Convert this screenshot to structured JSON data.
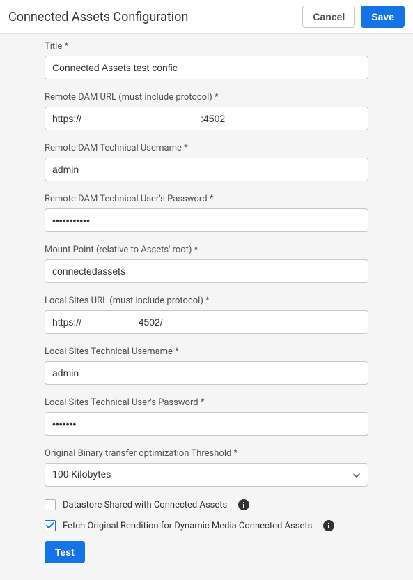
{
  "header": {
    "title": "Connected Assets Configuration",
    "cancel_label": "Cancel",
    "save_label": "Save"
  },
  "fields": {
    "title_label": "Title *",
    "title_value": "Connected Assets test confic",
    "remote_url_label": "Remote DAM URL (must include protocol) *",
    "remote_url_value": "https://                                            :4502",
    "remote_user_label": "Remote DAM Technical Username *",
    "remote_user_value": "admin",
    "remote_pw_label": "Remote DAM Technical User's Password *",
    "remote_pw_value": "•••••••••••",
    "mount_label": "Mount Point (relative to Assets' root) *",
    "mount_value": "connectedassets",
    "local_url_label": "Local Sites URL (must include protocol) *",
    "local_url_value": "https://                     4502/",
    "local_user_label": "Local Sites Technical Username *",
    "local_user_value": "admin",
    "local_pw_label": "Local Sites Technical User's Password *",
    "local_pw_value": "•••••••",
    "threshold_label": "Original Binary transfer optimization Threshold *",
    "threshold_value": "100 Kilobytes"
  },
  "checkboxes": {
    "datastore_label": "Datastore Shared with Connected Assets",
    "fetch_label": "Fetch Original Rendition for Dynamic Media Connected Assets"
  },
  "actions": {
    "test_label": "Test"
  }
}
